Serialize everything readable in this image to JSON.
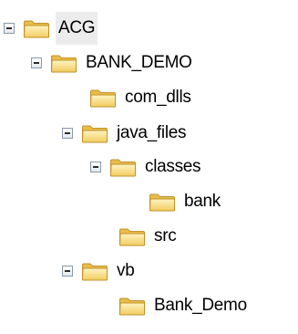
{
  "tree": {
    "nodes": [
      {
        "label": "ACG",
        "expanded": true,
        "selected": true
      },
      {
        "label": "BANK_DEMO",
        "expanded": true
      },
      {
        "label": "com_dlls"
      },
      {
        "label": "java_files",
        "expanded": true
      },
      {
        "label": "classes",
        "expanded": true
      },
      {
        "label": "bank"
      },
      {
        "label": "src"
      },
      {
        "label": "vb",
        "expanded": true
      },
      {
        "label": "Bank_Demo"
      }
    ]
  },
  "colors": {
    "folder_fill": "#f6d879",
    "folder_edge": "#c89a2c",
    "toggle_border": "#8a98a8"
  },
  "icons": {
    "toggle": "minus-box-icon",
    "node": "folder-open-icon"
  }
}
